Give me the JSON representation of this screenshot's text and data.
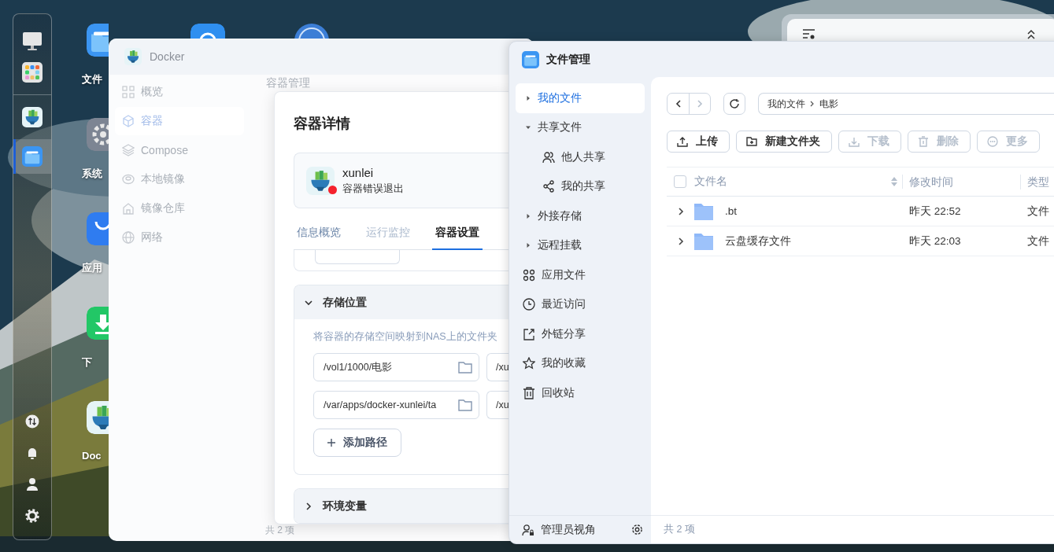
{
  "dock": {
    "apps": [
      {
        "kind": "docker",
        "selected": false
      },
      {
        "kind": "files",
        "selected": true
      }
    ]
  },
  "desktop": {
    "icons": [
      {
        "kind": "files",
        "label": "文件"
      },
      {
        "kind": "settings",
        "label": "系统"
      },
      {
        "kind": "store",
        "label": "应用"
      },
      {
        "kind": "download",
        "label": "下"
      },
      {
        "kind": "docker",
        "label": "Doc"
      }
    ],
    "top_row": [
      {
        "kind": "sync"
      },
      {
        "kind": "qb"
      }
    ]
  },
  "docker_window": {
    "title": "Docker",
    "sidebar": [
      {
        "label": "概览",
        "selected": false
      },
      {
        "label": "容器",
        "selected": true
      },
      {
        "label": "Compose",
        "selected": false
      },
      {
        "label": "本地镜像",
        "selected": false
      },
      {
        "label": "镜像仓库",
        "selected": false
      },
      {
        "label": "网络",
        "selected": false
      }
    ],
    "heading": "容器管理",
    "footer": "共 2 项",
    "dialog": {
      "title": "容器详情",
      "name": "xunlei",
      "status": {
        "text": "容器错误退出",
        "color": "#f5222d"
      },
      "tabs": [
        {
          "label": "信息概览",
          "selected": false,
          "disabled": false
        },
        {
          "label": "运行监控",
          "selected": false,
          "disabled": true
        },
        {
          "label": "容器设置",
          "selected": true,
          "disabled": false
        }
      ],
      "sections": [
        {
          "title": "存储位置",
          "expanded": true,
          "description": "将容器的存储空间映射到NAS上的文件夹",
          "mounts": [
            {
              "host": "/vol1/1000/电影",
              "container": "/xu"
            },
            {
              "host": "/var/apps/docker-xunlei/ta",
              "container": "/xu"
            }
          ],
          "add_button": "添加路径"
        },
        {
          "title": "环境变量",
          "expanded": false
        }
      ]
    }
  },
  "file_window": {
    "title": "文件管理",
    "sidebar": [
      {
        "kind": "tree",
        "label": "我的文件",
        "selected": true,
        "expanded": false
      },
      {
        "kind": "tree",
        "label": "共享文件",
        "selected": false,
        "expanded": true,
        "children": [
          {
            "kind": "link",
            "label": "他人共享",
            "selected": false
          },
          {
            "kind": "link",
            "label": "我的共享",
            "selected": false
          }
        ]
      },
      {
        "kind": "tree",
        "label": "外接存储",
        "selected": false,
        "expanded": false
      },
      {
        "kind": "tree",
        "label": "远程挂载",
        "selected": false,
        "expanded": false
      },
      {
        "kind": "link",
        "label": "应用文件",
        "selected": false
      },
      {
        "kind": "link",
        "label": "最近访问",
        "selected": false
      },
      {
        "kind": "link",
        "label": "外链分享",
        "selected": false
      },
      {
        "kind": "link",
        "label": "我的收藏",
        "selected": false
      },
      {
        "kind": "link",
        "label": "回收站",
        "selected": false
      }
    ],
    "admin_view": "管理员视角",
    "nav": [
      {
        "disabled": false
      },
      {
        "disabled": true
      }
    ],
    "path": [
      "我的文件",
      "电影"
    ],
    "toolbar": [
      {
        "label": "上传",
        "disabled": false
      },
      {
        "label": "新建文件夹",
        "disabled": false
      },
      {
        "label": "下载",
        "disabled": true
      },
      {
        "label": "删除",
        "disabled": true
      },
      {
        "label": "更多",
        "disabled": true
      }
    ],
    "select_all": {
      "checked": false
    },
    "columns": [
      "文件名",
      "修改时间",
      "类型"
    ],
    "rows": [
      {
        "name": ".bt",
        "modified": "昨天 22:52",
        "type": "文件"
      },
      {
        "name": "云盘缓存文件",
        "modified": "昨天 22:03",
        "type": "文件"
      }
    ],
    "footer": "共 2 项"
  }
}
